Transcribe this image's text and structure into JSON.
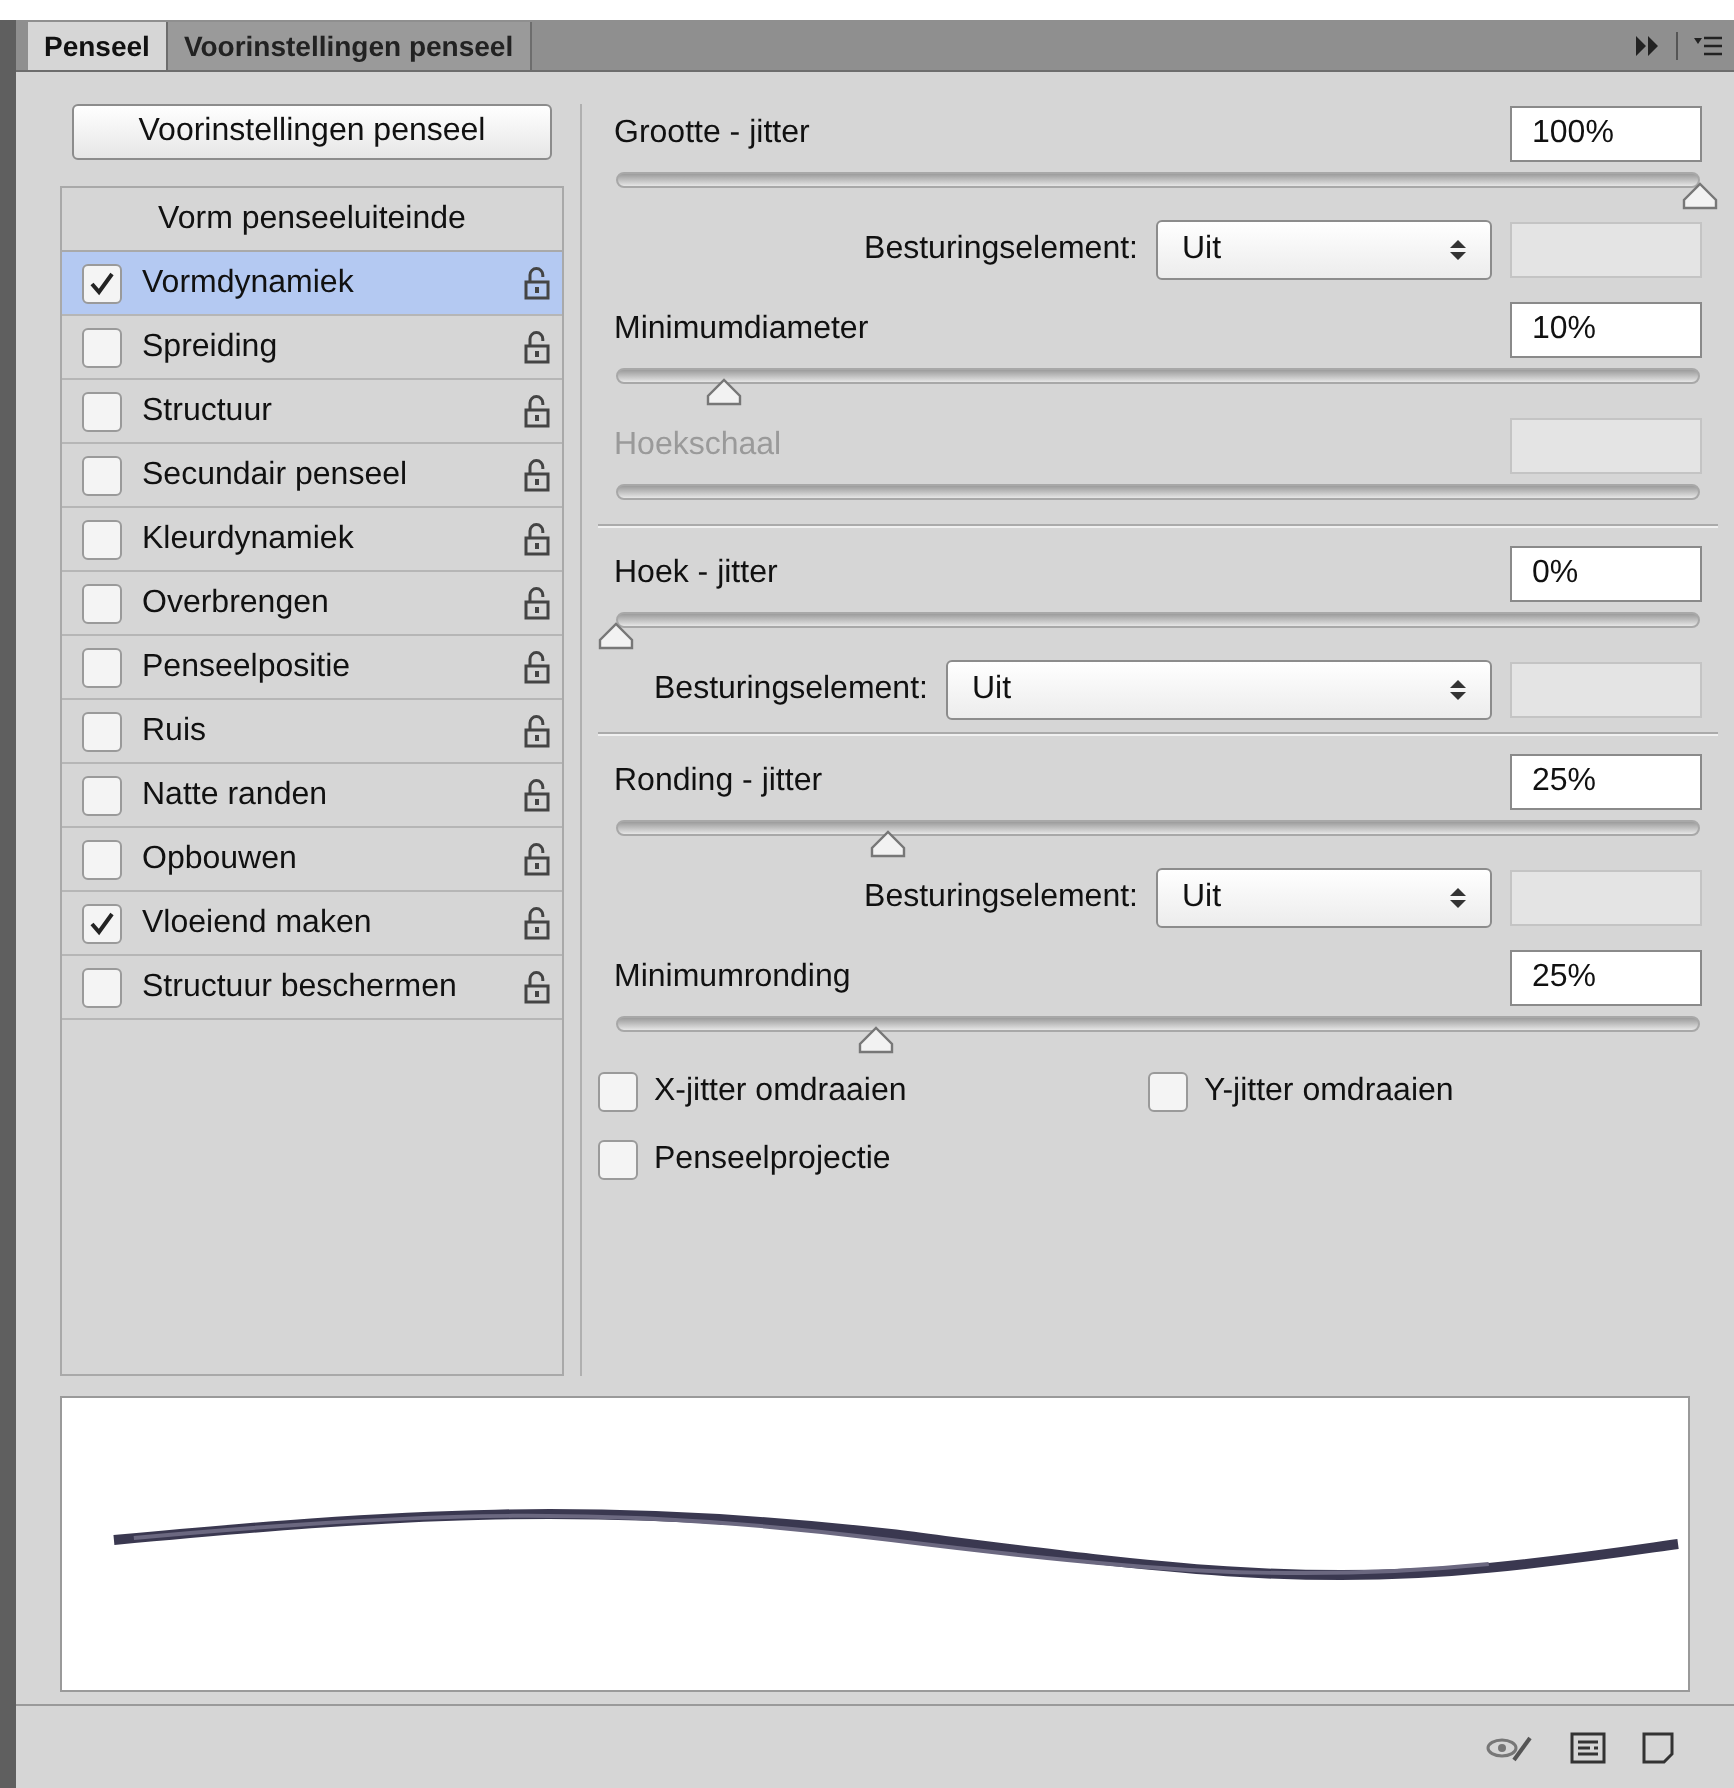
{
  "tabs": [
    {
      "label": "Penseel",
      "selected": true
    },
    {
      "label": "Voorinstellingen penseel",
      "selected": false
    }
  ],
  "presets_button": "Voorinstellingen penseel",
  "options": [
    {
      "kind": "header",
      "label": "Vorm penseeluiteinde"
    },
    {
      "kind": "option",
      "label": "Vormdynamiek",
      "checked": true,
      "selected": true
    },
    {
      "kind": "option",
      "label": "Spreiding",
      "checked": false,
      "selected": false
    },
    {
      "kind": "option",
      "label": "Structuur",
      "checked": false,
      "selected": false
    },
    {
      "kind": "option",
      "label": "Secundair penseel",
      "checked": false,
      "selected": false
    },
    {
      "kind": "option",
      "label": "Kleurdynamiek",
      "checked": false,
      "selected": false
    },
    {
      "kind": "option",
      "label": "Overbrengen",
      "checked": false,
      "selected": false
    },
    {
      "kind": "option",
      "label": "Penseelpositie",
      "checked": false,
      "selected": false
    },
    {
      "kind": "option",
      "label": "Ruis",
      "checked": false,
      "selected": false
    },
    {
      "kind": "option",
      "label": "Natte randen",
      "checked": false,
      "selected": false
    },
    {
      "kind": "option",
      "label": "Opbouwen",
      "checked": false,
      "selected": false
    },
    {
      "kind": "option",
      "label": "Vloeiend maken",
      "checked": true,
      "selected": false
    },
    {
      "kind": "option",
      "label": "Structuur beschermen",
      "checked": false,
      "selected": false
    }
  ],
  "settings": [
    {
      "kind": "slider",
      "label": "Grootte - jitter",
      "value": "100%",
      "level": 1.0,
      "disabled": false
    },
    {
      "kind": "control",
      "label": "Besturingselement:",
      "option": "Uit"
    },
    {
      "kind": "slider",
      "label": "Minimumdiameter",
      "value": "10%",
      "level": 0.1,
      "disabled": false
    },
    {
      "kind": "slider",
      "label": "Hoekschaal",
      "disabled": true
    },
    {
      "kind": "divider"
    },
    {
      "kind": "slider",
      "label": "Hoek - jitter",
      "value": "0%",
      "level": 0,
      "disabled": false
    },
    {
      "kind": "wide_control",
      "label": "Besturingselement:",
      "option": "Uit"
    },
    {
      "kind": "divider"
    },
    {
      "kind": "slider",
      "label": "Ronding - jitter",
      "value": "25%",
      "level": 0.25,
      "disabled": false
    },
    {
      "kind": "control",
      "label": "Besturingselement:",
      "option": "Uit"
    },
    {
      "kind": "slider",
      "label": "Minimumronding",
      "value": "25%",
      "level": 0.24,
      "disabled": false
    }
  ],
  "checkboxes": [
    {
      "label": "X-jitter omdraaien",
      "checked": false
    },
    {
      "label": "Y-jitter omdraaien",
      "checked": false
    },
    {
      "label": "Penseelprojectie",
      "checked": false
    }
  ]
}
